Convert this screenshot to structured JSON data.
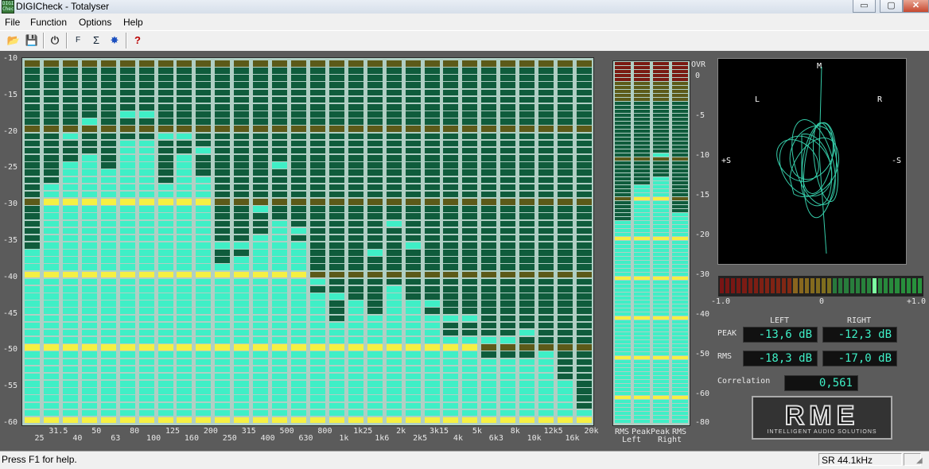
{
  "window": {
    "title": "DIGICheck - Totalyser",
    "app_icon_text": "DIGI Check",
    "minimize": "▭",
    "maximize": "▢",
    "close": "✕"
  },
  "menu": [
    "File",
    "Function",
    "Options",
    "Help"
  ],
  "toolbar": {
    "icons": [
      "open-folder-icon",
      "save-icon",
      "power-icon",
      "function-icon",
      "analysis-icon",
      "settings-icon",
      "help-icon"
    ],
    "glyphs": [
      "📂",
      "💾",
      "⏻",
      "F",
      "Σ",
      "✸",
      "?"
    ]
  },
  "spectrum": {
    "y_ticks": [
      "-10",
      "-15",
      "-20",
      "-25",
      "-30",
      "-35",
      "-40",
      "-45",
      "-50",
      "-55",
      "-60"
    ],
    "bands": [
      "25",
      "31.5",
      "40",
      "50",
      "63",
      "80",
      "100",
      "125",
      "160",
      "200",
      "250",
      "315",
      "400",
      "500",
      "630",
      "800",
      "1k",
      "1k25",
      "1k6",
      "2k",
      "2k5",
      "3k15",
      "4k",
      "5k",
      "6k3",
      "8k",
      "10k",
      "12k5",
      "16k",
      "20k"
    ],
    "levels_db": [
      -36.8,
      -27.8,
      -23.8,
      -22.8,
      -25.7,
      -20.6,
      -20.6,
      -26.7,
      -22.7,
      -25.7,
      -37.8,
      -36.8,
      -33.7,
      -31.7,
      -34.7,
      -41.8,
      -45.8,
      -42.8,
      -44.8,
      -40.8,
      -42.8,
      -44.8,
      -47.8,
      -47.8,
      -50.8,
      -50.8,
      -50.8,
      -50.8,
      -53.9,
      -58.9
    ],
    "peaks_db": [
      -36.8,
      -27.8,
      -20.1,
      -18.9,
      -25.7,
      -17.9,
      -17.9,
      -20.9,
      -20.9,
      -22.9,
      -35.9,
      -35.9,
      -30.9,
      -24.9,
      -33.9,
      -40.8,
      -42.8,
      -39.9,
      -36.9,
      -32.9,
      -35.9,
      -43.9,
      -45.8,
      -45.8,
      -48.9,
      -48.9,
      -47.9,
      -50.8,
      -55.9,
      -58.9
    ]
  },
  "meters": {
    "y_ticks": [
      "OVR",
      "0",
      "-5",
      "-10",
      "-15",
      "-20",
      "-30",
      "-40",
      "-50",
      "-60",
      "-80"
    ],
    "labels_top": [
      "RMS",
      "Peak",
      "Peak",
      "RMS"
    ],
    "labels_bottom": [
      "Left",
      "Right"
    ],
    "levels_db": [
      -18.3,
      -13.6,
      -12.3,
      -17.0
    ],
    "peaks_db": [
      -18.3,
      -13.6,
      -9.8,
      -17.0
    ]
  },
  "goniometer": {
    "top": "M",
    "left_label": "L",
    "right_label": "R",
    "plus_s": "+S",
    "minus_s": "-S"
  },
  "correlation": {
    "min": "-1.0",
    "mid": "0",
    "max": "+1.0",
    "value": 0.561
  },
  "readouts": {
    "left_header": "LEFT",
    "right_header": "RIGHT",
    "peak_label": "PEAK",
    "rms_label": "RMS",
    "correlation_label": "Correlation",
    "peak_left": "-13,6 dB",
    "peak_right": "-12,3 dB",
    "rms_left": "-18,3 dB",
    "rms_right": "-17,0 dB",
    "correlation_value": "0,561"
  },
  "logo": {
    "main": "RME",
    "sub": "INTELLIGENT AUDIO SOLUTIONS"
  },
  "status": {
    "help": "Press F1 for help.",
    "sample_rate": "SR 44.1kHz"
  },
  "colors": {
    "on_green": "#3fefc6",
    "off_green": "#0f5c3c",
    "on_yellow": "#f5f043",
    "off_yellow": "#5c5a19",
    "red": "#e22",
    "bg": "#5b5b5b"
  }
}
